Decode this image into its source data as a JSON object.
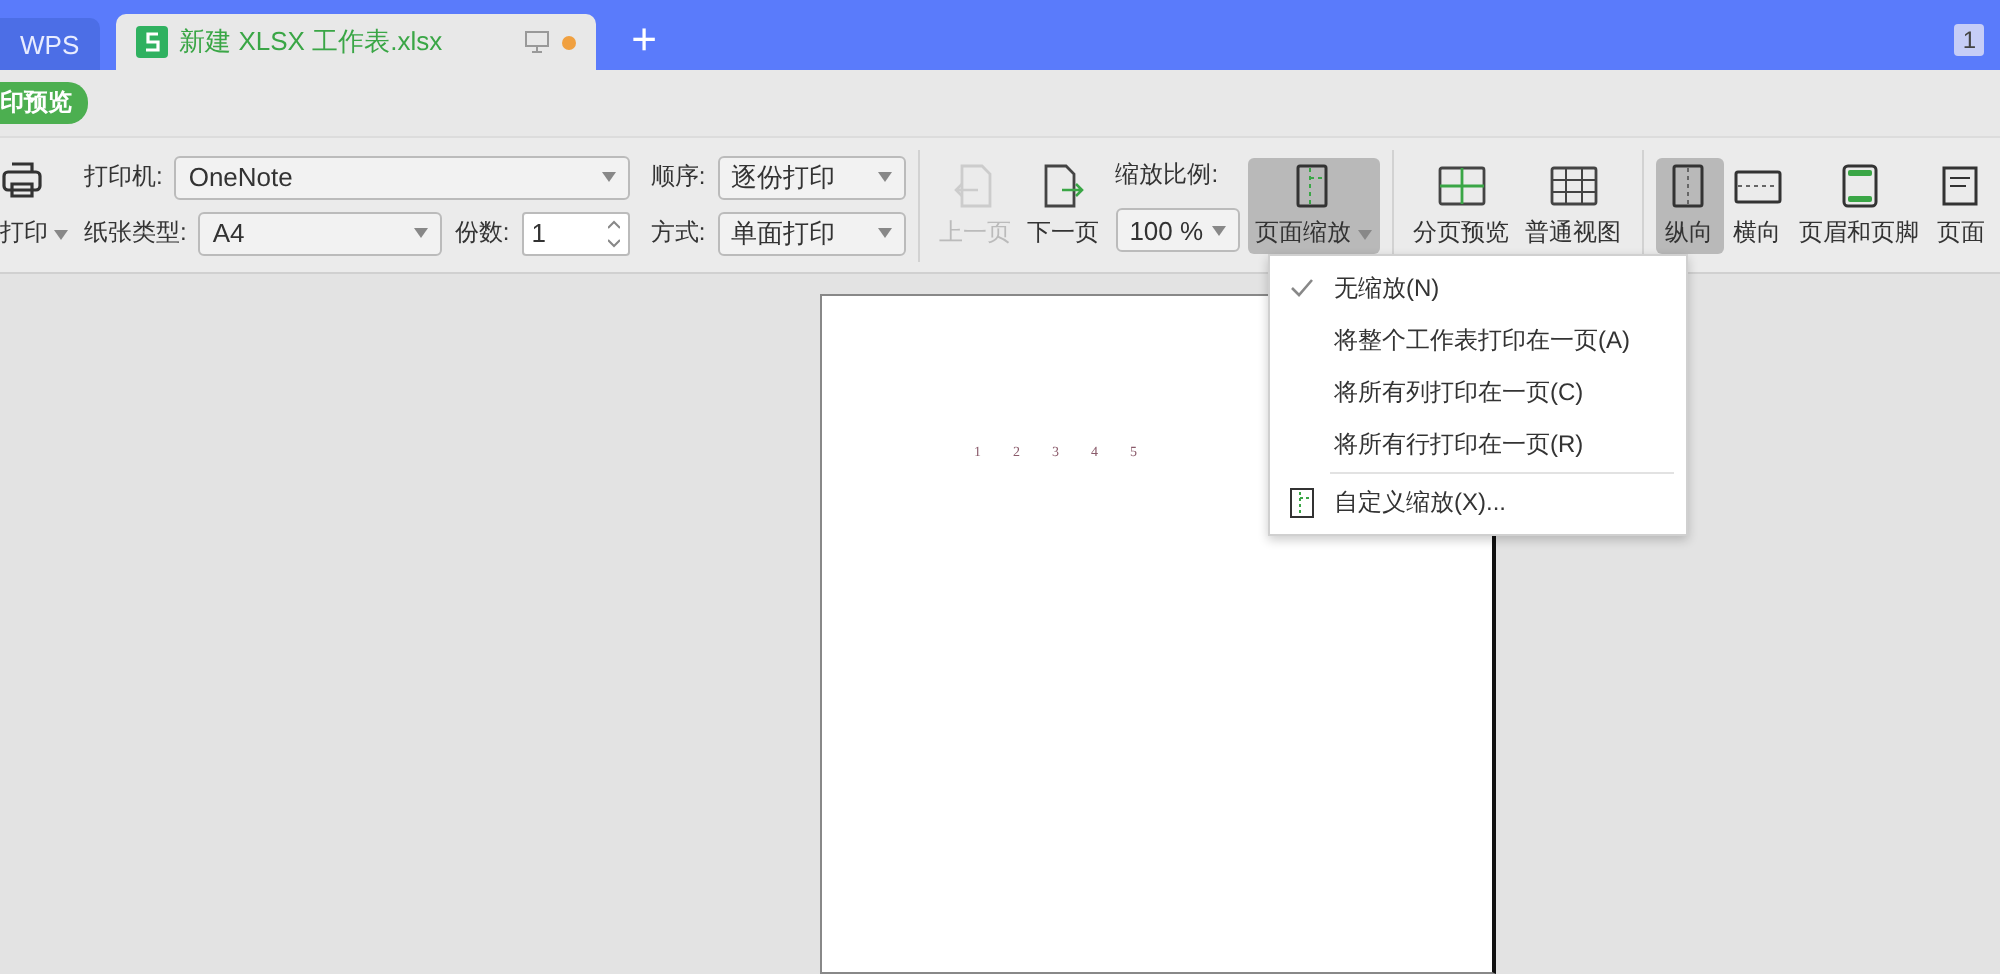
{
  "tabs": [
    {
      "label": "WPS",
      "selected": false
    },
    {
      "label": "新建 XLSX 工作表.xlsx",
      "selected": true,
      "unsaved": true
    }
  ],
  "new_tab": "+",
  "window_badge": "1",
  "mode_pill": "印预览",
  "print_button": {
    "label": "打印"
  },
  "printer": {
    "label": "打印机:",
    "value": "OneNote"
  },
  "paper": {
    "label": "纸张类型:",
    "value": "A4"
  },
  "copies": {
    "label": "份数:",
    "value": "1"
  },
  "order": {
    "label": "顺序:",
    "value": "逐份打印"
  },
  "mode": {
    "label": "方式:",
    "value": "单面打印"
  },
  "nav_buttons": [
    {
      "kind": "prev",
      "label": "上一页",
      "disabled": true
    },
    {
      "kind": "next",
      "label": "下一页",
      "disabled": false
    }
  ],
  "zoom": {
    "label": "缩放比例:",
    "value": "100 %"
  },
  "zoom_button": {
    "label": "页面缩放",
    "active": true
  },
  "view_buttons": [
    {
      "kind": "pagebreak",
      "label": "分页预览",
      "selected": false
    },
    {
      "kind": "normal",
      "label": "普通视图",
      "selected": false
    }
  ],
  "layout_buttons": [
    {
      "kind": "portrait",
      "label": "纵向",
      "selected": true
    },
    {
      "kind": "landscape",
      "label": "横向",
      "selected": false
    },
    {
      "kind": "header",
      "label": "页眉和页脚",
      "selected": false
    },
    {
      "kind": "setup",
      "label": "页面",
      "selected": false
    }
  ],
  "page_numbers": [
    "1",
    "2",
    "3",
    "4",
    "5"
  ],
  "zoom_menu": [
    {
      "kind": "option",
      "label": "无缩放(N)",
      "checked": true
    },
    {
      "kind": "option",
      "label": "将整个工作表打印在一页(A)",
      "checked": false
    },
    {
      "kind": "option",
      "label": "将所有列打印在一页(C)",
      "checked": false
    },
    {
      "kind": "option",
      "label": "将所有行打印在一页(R)",
      "checked": false
    },
    {
      "kind": "custom",
      "label": "自定义缩放(X)..."
    }
  ]
}
